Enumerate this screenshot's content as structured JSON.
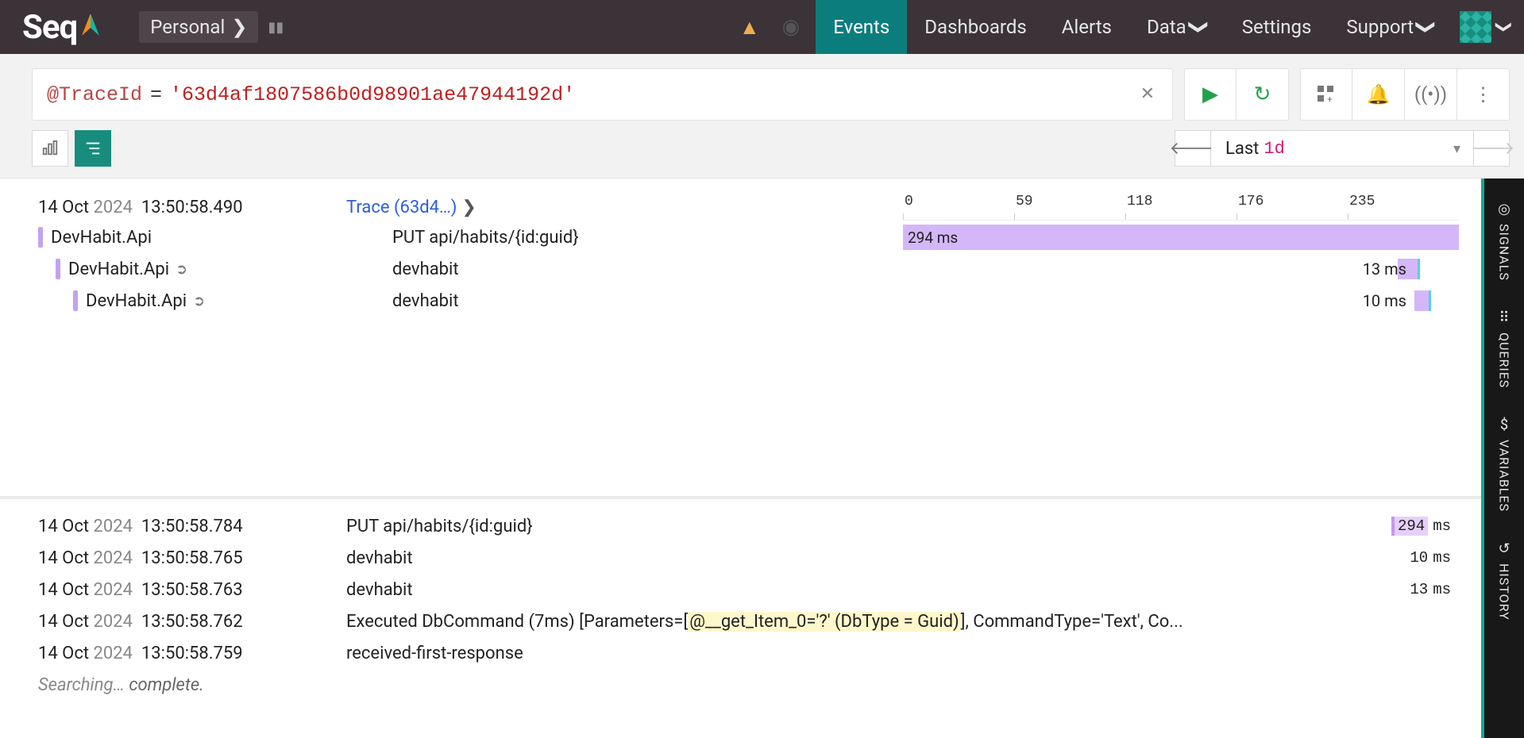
{
  "brand": "Seq",
  "workspace": "Personal",
  "nav": {
    "events": "Events",
    "dashboards": "Dashboards",
    "alerts": "Alerts",
    "data": "Data",
    "settings": "Settings",
    "support": "Support"
  },
  "query": {
    "property": "@TraceId",
    "operator": "=",
    "value": "'63d4af1807586b0d98901ae47944192d'"
  },
  "range": {
    "label": "Last",
    "unit": "1d"
  },
  "ruler": [
    "0",
    "59",
    "118",
    "176",
    "235"
  ],
  "trace_header": {
    "date": "14 Oct",
    "year": "2024",
    "time": "13:50:58.490",
    "link": "Trace (63d4…)"
  },
  "spans": [
    {
      "indent": 0,
      "service": "DevHabit.Api",
      "has_post_icon": false,
      "op": "PUT api/habits/{id:guid}",
      "left_pct": 0,
      "width_pct": 100,
      "bar_label": "294 ms",
      "out_label": ""
    },
    {
      "indent": 1,
      "service": "DevHabit.Api",
      "has_post_icon": true,
      "op": "devhabit",
      "left_pct": 89,
      "width_pct": 4,
      "bar_label": "",
      "out_label": "13 ms"
    },
    {
      "indent": 2,
      "service": "DevHabit.Api",
      "has_post_icon": true,
      "op": "devhabit",
      "left_pct": 92,
      "width_pct": 3,
      "bar_label": "",
      "out_label": "10 ms"
    }
  ],
  "logs": [
    {
      "date": "14 Oct",
      "year": "2024",
      "time": "13:50:58.784",
      "msg": "PUT api/habits/{id:guid}",
      "chip": "294",
      "chip_hl": true
    },
    {
      "date": "14 Oct",
      "year": "2024",
      "time": "13:50:58.765",
      "msg": "devhabit",
      "chip": "10",
      "chip_hl": false
    },
    {
      "date": "14 Oct",
      "year": "2024",
      "time": "13:50:58.763",
      "msg": "devhabit",
      "chip": "13",
      "chip_hl": false
    },
    {
      "date": "14 Oct",
      "year": "2024",
      "time": "13:50:58.762",
      "msg": "",
      "chip": "",
      "chip_hl": false,
      "msg_parts": [
        "Executed DbCommand (7ms) [Parameters=[",
        "@__get_Item_0='?' (DbType = Guid)",
        "], CommandType='Text', Co..."
      ]
    },
    {
      "date": "14 Oct",
      "year": "2024",
      "time": "13:50:58.759",
      "msg": "received-first-response",
      "chip": "",
      "chip_hl": false
    }
  ],
  "search_status_a": "Searching…",
  "search_status_b": "complete.",
  "rail": {
    "signals": "SIGNALS",
    "queries": "QUERIES",
    "variables": "VARIABLES",
    "history": "HISTORY"
  }
}
